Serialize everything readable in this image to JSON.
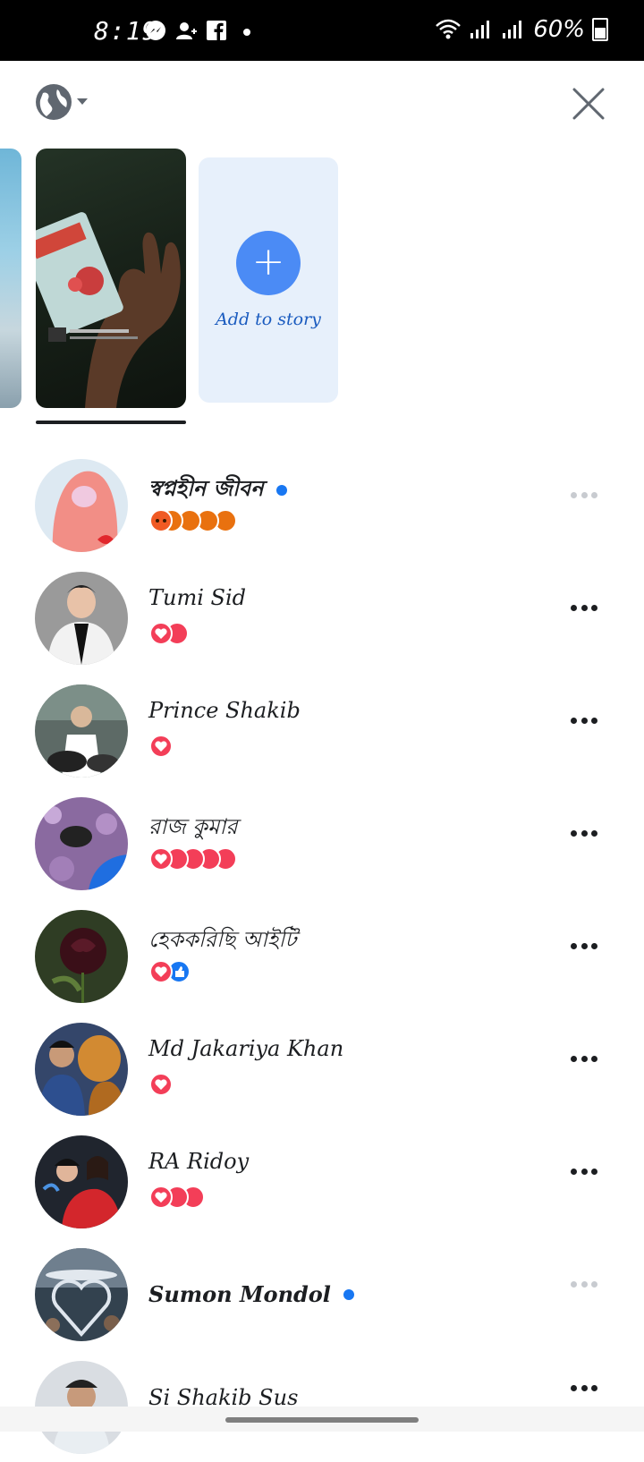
{
  "status": {
    "time": "8:19",
    "battery": "60%",
    "left_icons": [
      "messenger-icon",
      "add-friend-icon",
      "facebook-icon",
      "dot-icon"
    ],
    "right_icons": [
      "wifi-icon",
      "signal-icon",
      "signal-icon-2"
    ]
  },
  "header": {
    "privacy_icon": "globe-icon",
    "close_icon": "close-icon"
  },
  "stories": {
    "add_label": "Add to story",
    "add_icon": "plus-icon"
  },
  "viewers": [
    {
      "name": "স্বপ্নহীন জীবন",
      "bold": true,
      "online": true,
      "reactions": "angry x5",
      "more_dim": true
    },
    {
      "name": "Tumi Sid",
      "bold": false,
      "online": false,
      "reactions": "love x2",
      "more_dim": false
    },
    {
      "name": "Prince Shakib",
      "bold": false,
      "online": false,
      "reactions": "love x1",
      "more_dim": false
    },
    {
      "name": "রাজ কুমার",
      "bold": false,
      "online": false,
      "reactions": "love x5",
      "more_dim": false
    },
    {
      "name": "হেককরিছি আইটি",
      "bold": false,
      "online": false,
      "reactions": "love + like",
      "more_dim": false
    },
    {
      "name": "Md Jakariya Khan",
      "bold": false,
      "online": false,
      "reactions": "love x1",
      "more_dim": false
    },
    {
      "name": "RA Ridoy",
      "bold": false,
      "online": false,
      "reactions": "love x3",
      "more_dim": false
    },
    {
      "name": "Sumon Mondol",
      "bold": true,
      "online": true,
      "reactions": "",
      "more_dim": true
    },
    {
      "name": "Si Shakib Sus",
      "bold": false,
      "online": false,
      "reactions": "",
      "more_dim": false
    }
  ],
  "colors": {
    "accent": "#1877f2",
    "add_button": "#4b8bf5",
    "add_card_bg": "#e7f0fb",
    "love": "#f33e58",
    "angry": "#e9710f"
  }
}
